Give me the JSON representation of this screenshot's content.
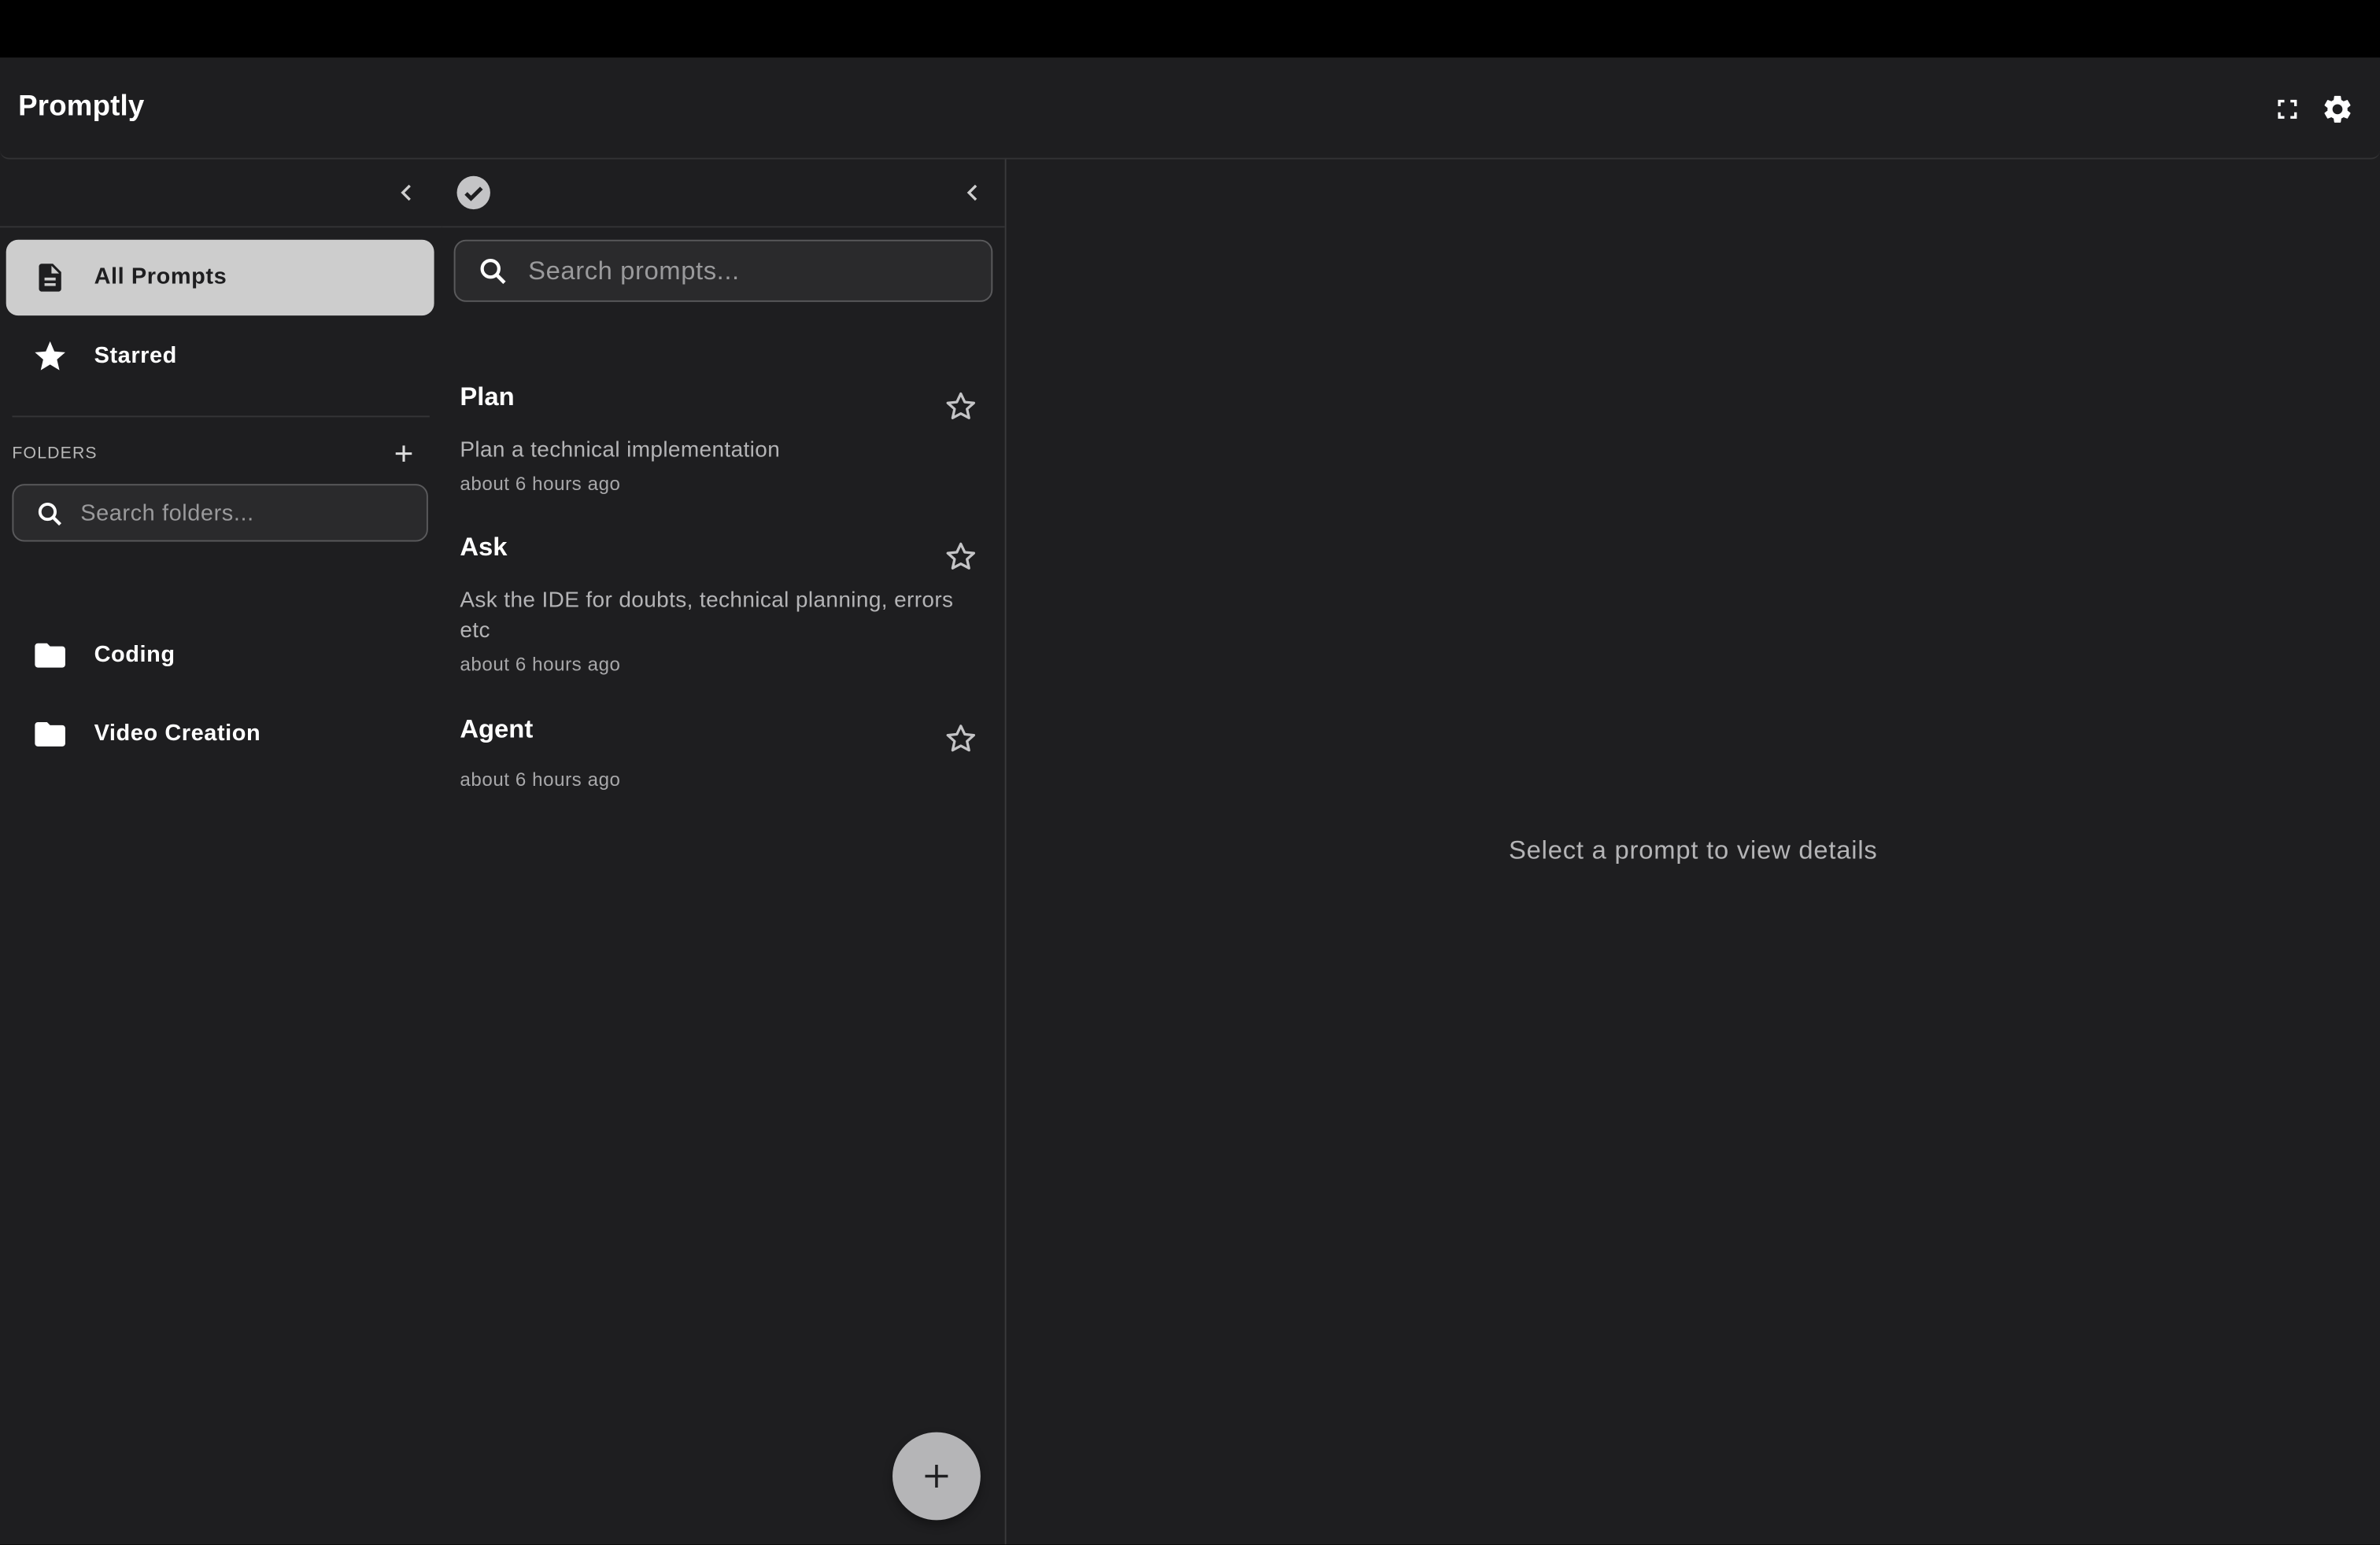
{
  "app": {
    "title": "Promptly"
  },
  "header": {
    "fullscreen_icon": "fullscreen-icon",
    "settings_icon": "gear-icon"
  },
  "sidebar": {
    "nav": [
      {
        "label": "All Prompts",
        "icon": "document-icon",
        "active": true
      },
      {
        "label": "Starred",
        "icon": "star-icon",
        "active": false
      }
    ],
    "folders_heading": "FOLDERS",
    "folder_search_placeholder": "Search folders...",
    "folders": [
      {
        "label": "Coding",
        "icon": "folder-icon"
      },
      {
        "label": "Video Creation",
        "icon": "folder-icon"
      }
    ]
  },
  "prompt_list": {
    "search_placeholder": "Search prompts...",
    "items": [
      {
        "title": "Plan",
        "description": "Plan a technical implementation",
        "time": "about 6 hours ago",
        "starred": false
      },
      {
        "title": "Ask",
        "description": "Ask the IDE for doubts, technical planning, errors etc",
        "time": "about 6 hours ago",
        "starred": false
      },
      {
        "title": "Agent",
        "description": "",
        "time": "about 6 hours ago",
        "starred": false
      }
    ]
  },
  "detail": {
    "empty_message": "Select a prompt to view details"
  },
  "colors": {
    "background": "#1e1e20",
    "active_nav": "#cdcdcd",
    "fab": "#b5b5b7",
    "muted_text": "#b4b4b6"
  }
}
